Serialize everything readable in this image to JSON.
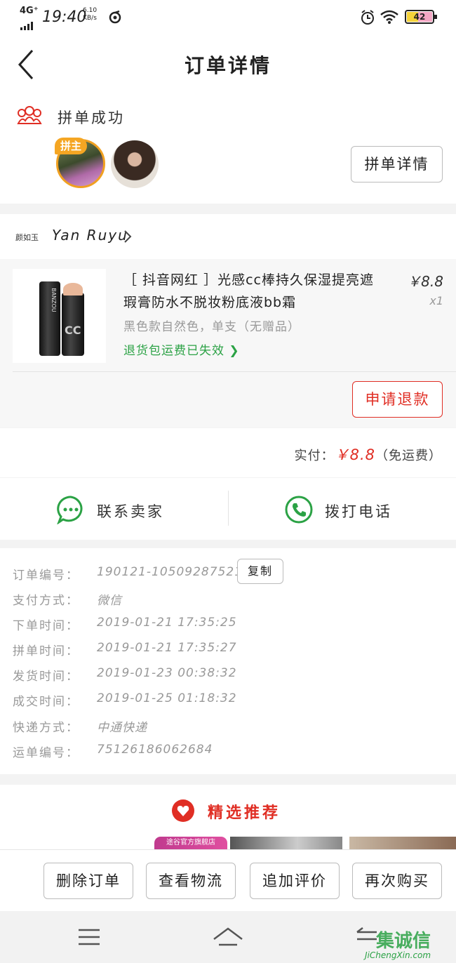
{
  "status_bar": {
    "network": "4G⁺",
    "time": "19:40",
    "speed": "6.10",
    "speed_unit": "KB/s",
    "battery": "42"
  },
  "header": {
    "title": "订单详情"
  },
  "group": {
    "status": "拼单成功",
    "leader_badge": "拼主",
    "details_button": "拼单详情"
  },
  "shop": {
    "logo_text": "颜如玉",
    "name": "Yan Ruyu"
  },
  "product": {
    "title": "［ 抖音网红 ］光感cc棒持久保湿提亮遮瑕膏防水不脱妆粉底液bb霜",
    "price": "￥8.8",
    "quantity": "x1",
    "spec": "黑色款自然色，单支（无赠品）",
    "shipping_note": "退货包运费已失效",
    "image_brand": "BANZOU",
    "refund_button": "申请退款"
  },
  "payment": {
    "label": "实付：",
    "amount": "￥8.8",
    "note": "（免运费）"
  },
  "contact": {
    "seller": "联系卖家",
    "call": "拨打电话"
  },
  "order_info": {
    "copy_button": "复制",
    "rows": [
      {
        "label": "订单编号：",
        "value": "190121-105092875211267"
      },
      {
        "label": "支付方式：",
        "value": "微信"
      },
      {
        "label": "下单时间：",
        "value": "2019-01-21 17:35:25"
      },
      {
        "label": "拼单时间：",
        "value": "2019-01-21 17:35:27"
      },
      {
        "label": "发货时间：",
        "value": "2019-01-23 00:38:32"
      },
      {
        "label": "成交时间：",
        "value": "2019-01-25 01:18:32"
      },
      {
        "label": "快递方式：",
        "value": "中通快递"
      },
      {
        "label": "运单编号：",
        "value": "75126186062684"
      }
    ]
  },
  "recommend": {
    "title": "精选推荐",
    "banner_text": "途谷官方旗舰店"
  },
  "actions": {
    "delete": "删除订单",
    "logistics": "查看物流",
    "review": "追加评价",
    "rebuy": "再次购买"
  },
  "watermark": {
    "site": "JiChengXin.com",
    "text": "集诚信"
  },
  "colors": {
    "accent_red": "#e02e24",
    "green": "#2ba245"
  }
}
